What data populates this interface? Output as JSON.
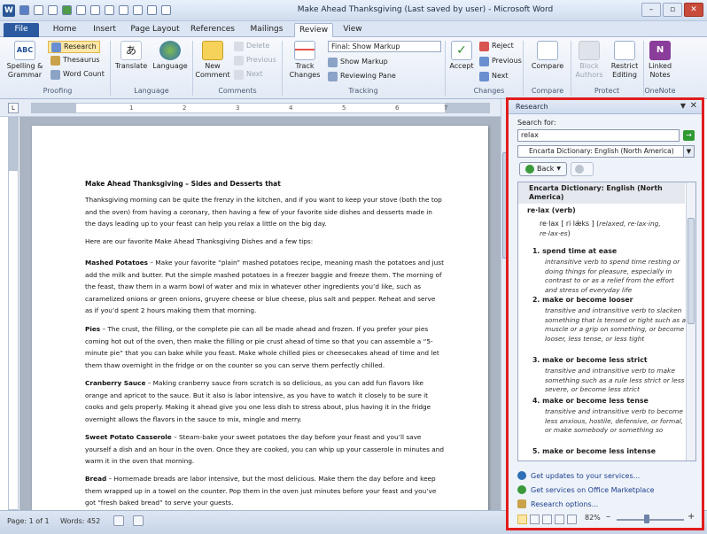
{
  "window": {
    "title": "Make Ahead Thanksgiving (Last saved by user) - Microsoft Word",
    "app_badge": "W",
    "controls": {
      "minimize": "–",
      "maximize": "▫",
      "close": "✕"
    }
  },
  "tabs": [
    "File",
    "Home",
    "Insert",
    "Page Layout",
    "References",
    "Mailings",
    "Review",
    "View"
  ],
  "active_tab": "Review",
  "ribbon": {
    "proofing": {
      "label": "Proofing",
      "spelling": "Spelling &",
      "spelling2": "Grammar",
      "research": "Research",
      "thesaurus": "Thesaurus",
      "word_count": "Word Count"
    },
    "language": {
      "label": "Language",
      "translate": "Translate",
      "language": "Language"
    },
    "comments": {
      "label": "Comments",
      "new": "New",
      "new2": "Comment",
      "delete": "Delete",
      "previous": "Previous",
      "next": "Next"
    },
    "tracking": {
      "label": "Tracking",
      "track": "Track",
      "track2": "Changes",
      "final_markup": "Final: Show Markup",
      "show_markup": "Show Markup",
      "reviewing_pane": "Reviewing Pane"
    },
    "changes": {
      "label": "Changes",
      "accept": "Accept",
      "reject": "Reject",
      "previous": "Previous",
      "next": "Next"
    },
    "compare": {
      "label": "Compare",
      "compare": "Compare"
    },
    "protect": {
      "label": "Protect",
      "block": "Block",
      "block2": "Authors",
      "restrict": "Restrict",
      "restrict2": "Editing"
    },
    "onenote": {
      "label": "OneNote",
      "linked": "Linked",
      "linked2": "Notes"
    }
  },
  "ruler": {
    "corner": "L",
    "numbers": [
      "1",
      "2",
      "3",
      "4",
      "5",
      "6",
      "7"
    ]
  },
  "document": {
    "title": "Make Ahead Thanksgiving – Sides and Desserts that",
    "intro": "Thanksgiving morning can be quite the frenzy in the kitchen, and if you want to keep your stove (both the top and the oven) from having a coronary, then having a few of your favorite side dishes and desserts made in the days leading up to your feast can help you relax a little on the big day.",
    "list_intro": "Here are our favorite Make Ahead Thanksgiving Dishes and a few tips:",
    "sections": [
      {
        "head": "Mashed Potatoes",
        "body": " – Make your favorite “plain” mashed potatoes recipe, meaning mash the potatoes and just add the milk and butter. Put the simple mashed potatoes in a freezer baggie and freeze them. The morning of the feast, thaw them in a warm bowl of water and mix in whatever other ingredients you’d like, such as caramelized onions or green onions, gruyere cheese or blue cheese, plus salt and pepper. Reheat and serve as if you’d spent 2 hours making them that morning."
      },
      {
        "head": "Pies",
        "body": " – The crust, the filling, or the complete pie can all be made ahead and frozen. If you prefer your pies coming hot out of the oven, then make the filling or pie crust ahead of time so that you can assemble a “5-minute pie” that you can bake while you feast. Make whole chilled pies or cheesecakes ahead of time and let them thaw overnight in the fridge or on the counter so you can serve them perfectly chilled."
      },
      {
        "head": "Cranberry Sauce",
        "body": " – Making cranberry sauce from scratch is so delicious, as you can add fun flavors like orange and apricot to the sauce. But it also is labor intensive, as you have to watch it closely to be sure it cooks and gels properly. Making it ahead give you one less dish to stress about, plus having it in the fridge overnight allows the flavors in the sauce to mix, mingle and merry."
      },
      {
        "head": "Sweet Potato Casserole",
        "body": " – Steam-bake your sweet potatoes the day before your feast and you’ll save yourself a dish and an hour in the oven. Once they are cooked, you can whip up your casserole in minutes and warm it in the oven that morning."
      },
      {
        "head": "Bread",
        "body": " – Homemade breads are labor intensive, but the most delicious. Make them the day before and keep them wrapped up in a towel on the counter. Pop them in the oven just minutes before your feast and you’ve got “fresh baked bread” to serve your guests."
      }
    ]
  },
  "status": {
    "page": "Page: 1 of 1",
    "words": "Words: 452",
    "zoom": "82%",
    "minus": "–",
    "plus": "+"
  },
  "research": {
    "title": "Research",
    "search_label": "Search for:",
    "query": "relax",
    "go": "→",
    "source": "Encarta Dictionary: English (North America)",
    "back": "Back",
    "result_source": "Encarta Dictionary: English (North America)",
    "headword": "re·lax (verb)",
    "pron_a": "re·lax [ ri lǽks ] (",
    "forms_a": "relaxed, re·lax·ing,",
    "forms_b": "re·lax·es",
    "pron_close": ")",
    "senses": [
      {
        "num": "1.",
        "title": "spend time at ease",
        "def": "intransitive verb to spend time resting or doing things for pleasure, especially in contrast to or as a relief from the effort and stress of everyday life"
      },
      {
        "num": "2.",
        "title": "make or become looser",
        "def": "transitive and intransitive verb to slacken something that is tensed or tight such as a muscle or a grip on something, or become looser, less tense, or less tight"
      },
      {
        "num": "3.",
        "title": "make or become less strict",
        "def": "transitive and intransitive verb to make something such as a rule less strict or less severe, or become less strict"
      },
      {
        "num": "4.",
        "title": "make or become less tense",
        "def": "transitive and intransitive verb to become less anxious, hostile, defensive, or formal, or make somebody or something so"
      },
      {
        "num": "5.",
        "title": "make or become less intense",
        "def": ""
      }
    ],
    "links": [
      "Get updates to your services...",
      "Get services on Office Marketplace",
      "Research options..."
    ]
  },
  "colors": {
    "accent": "#2c5aa0",
    "highlight": "#e11d1d"
  }
}
